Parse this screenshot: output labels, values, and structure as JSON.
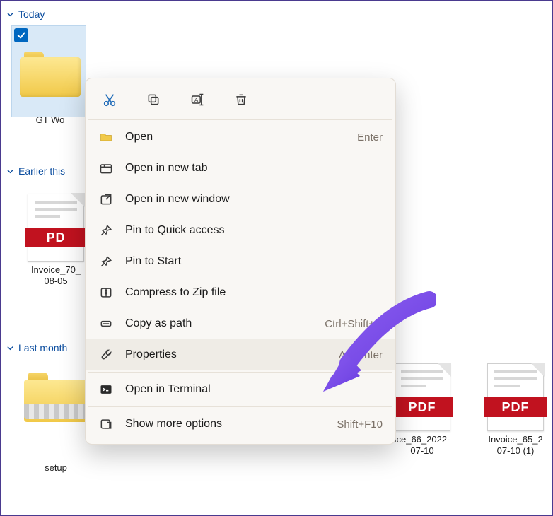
{
  "groups": {
    "today": "Today",
    "earlier_week": "Earlier this",
    "last_month": "Last month"
  },
  "files": {
    "selected_folder": "GT Wo",
    "pdf_earlier": "Invoice_70_\n08-05",
    "zip": "setup",
    "pdf2": "ice_66_2022-\n07-10",
    "pdf3": "Invoice_65_2\n07-10 (1)",
    "pdf_band": "PDF",
    "pdf_band_cut": "PD"
  },
  "context_menu": {
    "toolbar": {
      "cut": "cut",
      "copy": "copy",
      "rename": "rename",
      "delete": "delete"
    },
    "items": {
      "open": {
        "label": "Open",
        "accel": "Enter"
      },
      "open_new_tab": {
        "label": "Open in new tab",
        "accel": ""
      },
      "open_new_window": {
        "label": "Open in new window",
        "accel": ""
      },
      "pin_quick": {
        "label": "Pin to Quick access",
        "accel": ""
      },
      "pin_start": {
        "label": "Pin to Start",
        "accel": ""
      },
      "compress": {
        "label": "Compress to Zip file",
        "accel": ""
      },
      "copy_path": {
        "label": "Copy as path",
        "accel": "Ctrl+Shift+C"
      },
      "properties": {
        "label": "Properties",
        "accel": "Alt+Enter"
      },
      "terminal": {
        "label": "Open in Terminal",
        "accel": ""
      },
      "more": {
        "label": "Show more options",
        "accel": "Shift+F10"
      }
    }
  }
}
